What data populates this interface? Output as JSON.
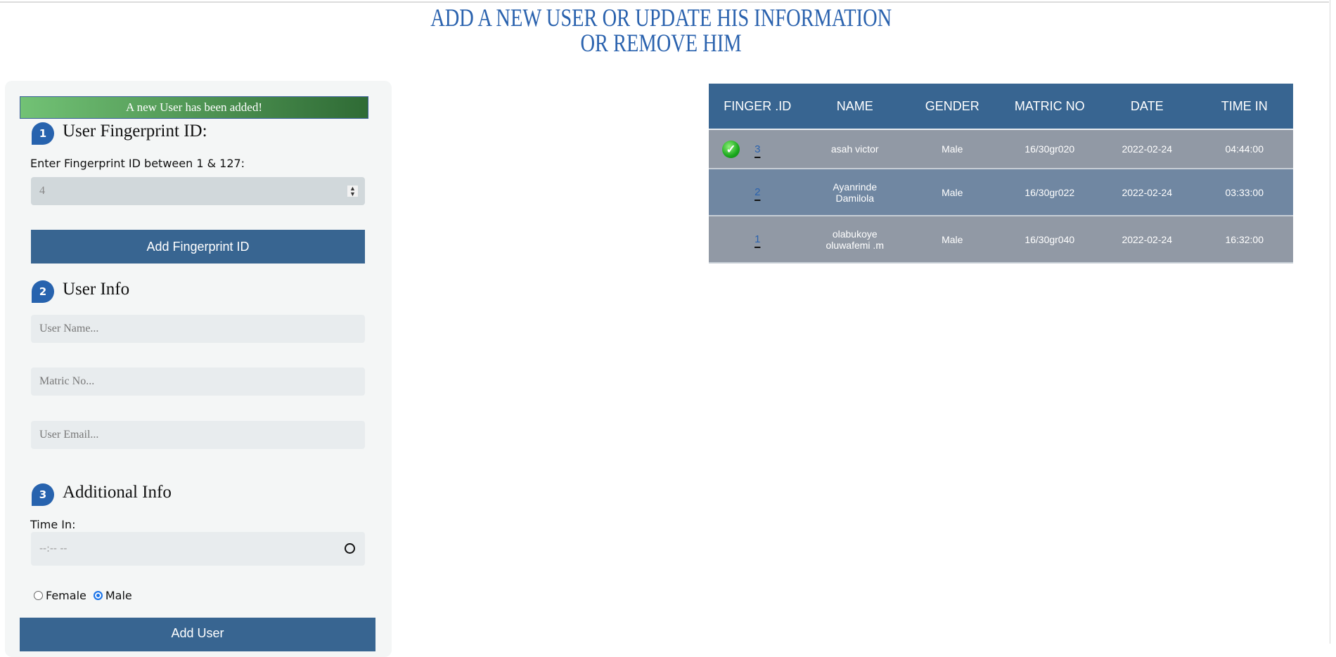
{
  "header": {
    "title_line1": "ADD A NEW USER OR UPDATE HIS INFORMATION",
    "title_line2": "OR REMOVE HIM"
  },
  "form": {
    "alert": "A new User has been added!",
    "section1": {
      "number": "1",
      "title": "User Fingerprint ID:",
      "label": "Enter Fingerprint ID between 1 & 127:",
      "value": "4",
      "button": "Add Fingerprint ID"
    },
    "section2": {
      "number": "2",
      "title": "User Info",
      "name_placeholder": "User Name...",
      "matric_placeholder": "Matric No...",
      "email_placeholder": "User Email..."
    },
    "section3": {
      "number": "3",
      "title": "Additional Info",
      "time_label": "Time In:",
      "time_placeholder": "--:-- --",
      "gender_options": [
        "Female",
        "Male"
      ],
      "gender_selected": "Male",
      "button": "Add User"
    }
  },
  "table": {
    "columns": [
      "FINGER .ID",
      "NAME",
      "GENDER",
      "MATRIC NO",
      "DATE",
      "TIME IN"
    ],
    "rows": [
      {
        "id": "3",
        "name": "asah victor",
        "gender": "Male",
        "matric": "16/30gr020",
        "date": "2022-02-24",
        "time": "04:44:00",
        "selected": true
      },
      {
        "id": "2",
        "name": "Ayanrinde Damilola",
        "gender": "Male",
        "matric": "16/30gr022",
        "date": "2022-02-24",
        "time": "03:33:00"
      },
      {
        "id": "1",
        "name": "olabukoye oluwafemi .m",
        "gender": "Male",
        "matric": "16/30gr040",
        "date": "2022-02-24",
        "time": "16:32:00"
      }
    ]
  },
  "colors": {
    "accent": "#386591",
    "title": "#2a62ae",
    "badge": "#2763ae"
  }
}
